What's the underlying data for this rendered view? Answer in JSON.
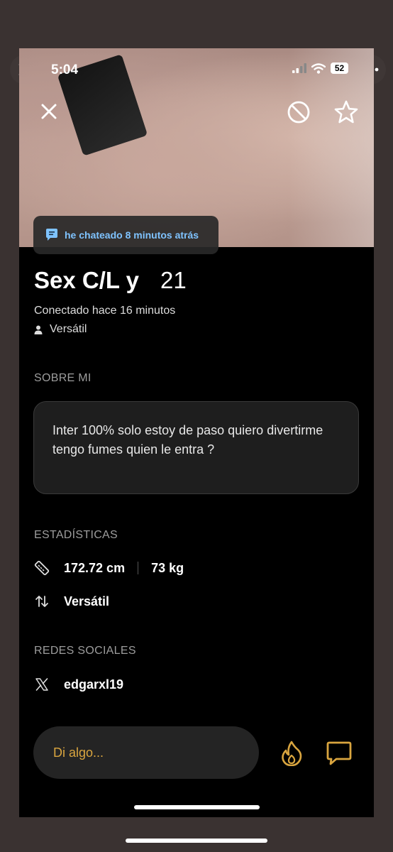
{
  "status_bar": {
    "time": "5:04",
    "battery": "52"
  },
  "profile": {
    "last_chat": "he chateado 8 minutos atrás",
    "name": "Sex C/L y",
    "age": "21",
    "online_status": "Conectado hace 16 minutos",
    "position": "Versátil"
  },
  "about": {
    "label": "SOBRE MI",
    "text": "Inter 100% solo estoy de paso quiero divertirme tengo fumes quien le entra ?"
  },
  "stats": {
    "label": "ESTADÍSTICAS",
    "height": "172.72 cm",
    "weight": "73 kg",
    "role": "Versátil"
  },
  "social": {
    "label": "REDES SOCIALES",
    "x_handle": "edgarxl19"
  },
  "composer": {
    "placeholder": "Di algo..."
  },
  "colors": {
    "accent": "#d9a53f",
    "chat_blue": "#7fc3ff",
    "background": "#000000"
  }
}
